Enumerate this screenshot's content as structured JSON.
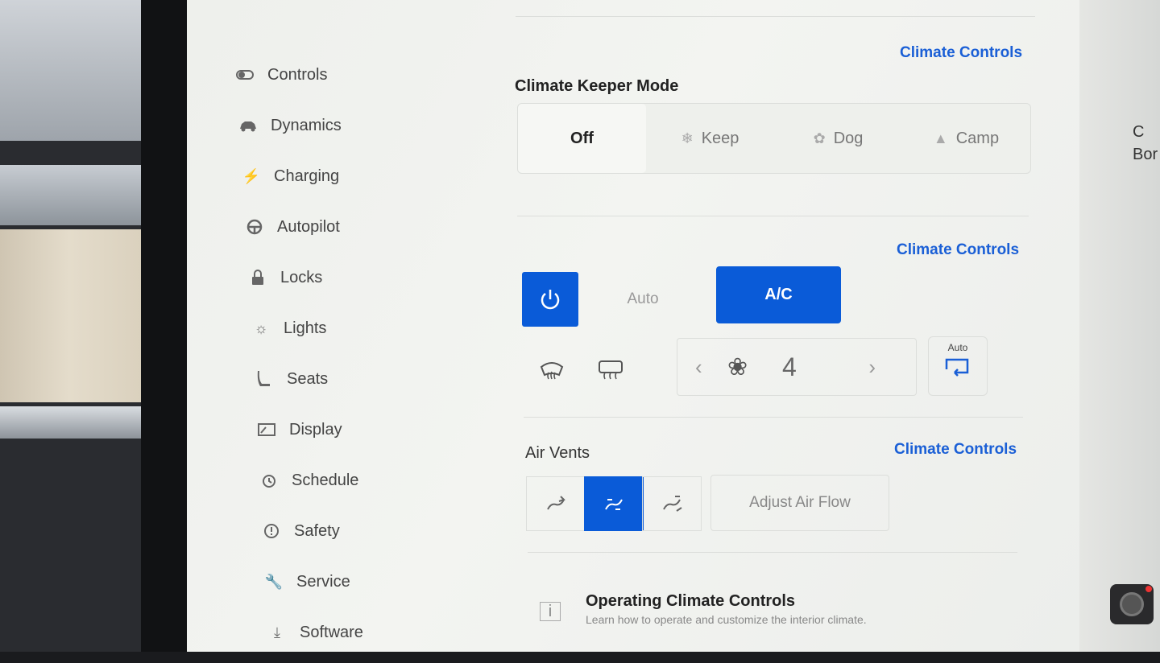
{
  "sidebar": {
    "items": [
      {
        "label": "Controls",
        "icon": "toggle-icon"
      },
      {
        "label": "Dynamics",
        "icon": "car-icon"
      },
      {
        "label": "Charging",
        "icon": "bolt-icon"
      },
      {
        "label": "Autopilot",
        "icon": "steering-wheel-icon"
      },
      {
        "label": "Locks",
        "icon": "lock-icon"
      },
      {
        "label": "Lights",
        "icon": "light-icon"
      },
      {
        "label": "Seats",
        "icon": "seat-icon"
      },
      {
        "label": "Display",
        "icon": "display-icon"
      },
      {
        "label": "Schedule",
        "icon": "alarm-clock-icon"
      },
      {
        "label": "Safety",
        "icon": "alert-icon"
      },
      {
        "label": "Service",
        "icon": "wrench-icon"
      },
      {
        "label": "Software",
        "icon": "download-icon"
      }
    ]
  },
  "keeper": {
    "link": "Climate Controls",
    "title": "Climate Keeper Mode",
    "options": [
      {
        "label": "Off",
        "active": true
      },
      {
        "label": "Keep",
        "active": false
      },
      {
        "label": "Dog",
        "active": false
      },
      {
        "label": "Camp",
        "active": false
      }
    ]
  },
  "climate": {
    "link": "Climate Controls",
    "auto_label": "Auto",
    "ac_label": "A/C",
    "fan_speed": "4",
    "recirc_label": "Auto"
  },
  "vents": {
    "title": "Air Vents",
    "link": "Climate Controls",
    "adjust_label": "Adjust Air Flow",
    "selected_index": 1
  },
  "help": {
    "title": "Operating Climate Controls",
    "subtitle": "Learn how to operate and customize the interior climate."
  },
  "edge_text": {
    "line1": "C",
    "line2": "Bor"
  },
  "colors": {
    "accent": "#0a5bd8",
    "link": "#1a5fd6"
  }
}
